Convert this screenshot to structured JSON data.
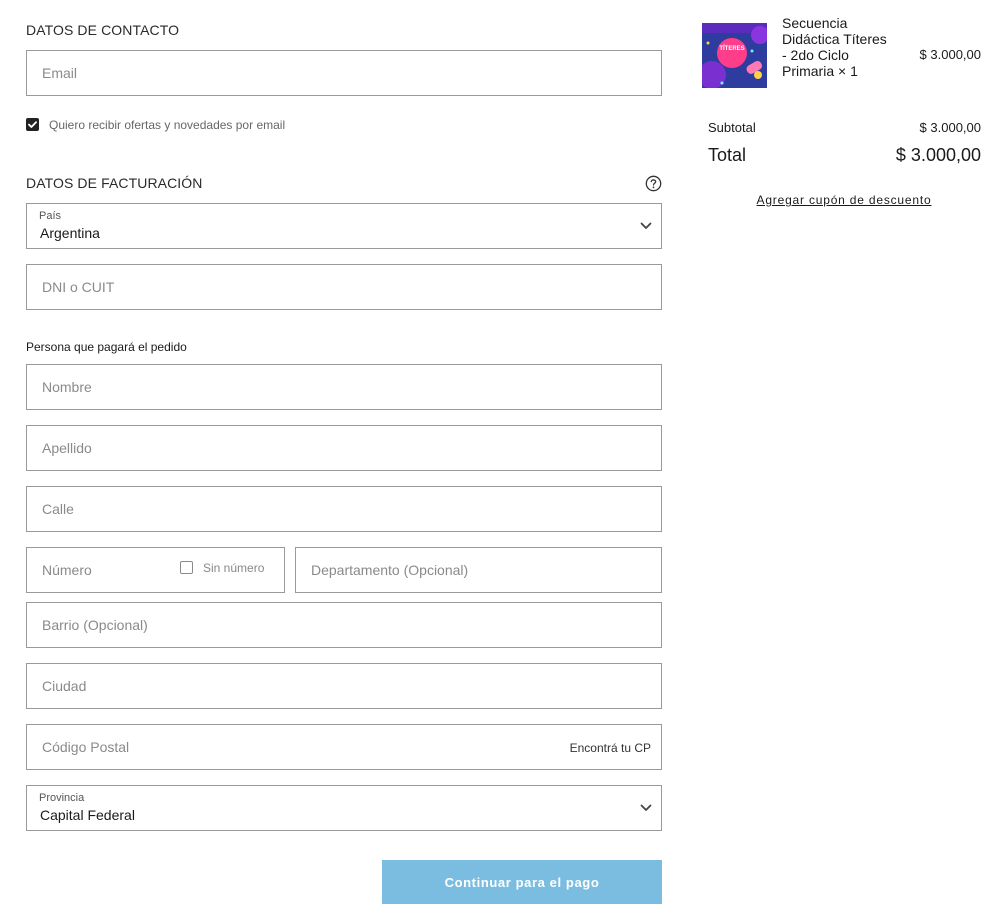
{
  "contact": {
    "title": "DATOS DE CONTACTO",
    "email_placeholder": "Email",
    "offers_label": "Quiero recibir ofertas y novedades por email"
  },
  "billing": {
    "title": "DATOS DE FACTURACIÓN",
    "help_icon": "question-circle-icon",
    "country_label": "País",
    "country_value": "Argentina",
    "dni_placeholder": "DNI o CUIT",
    "payer_title": "Persona que pagará el pedido",
    "name_placeholder": "Nombre",
    "lastname_placeholder": "Apellido",
    "street_placeholder": "Calle",
    "number_placeholder": "Número",
    "no_number_label": "Sin número",
    "apartment_placeholder": "Departamento (Opcional)",
    "neighborhood_placeholder": "Barrio (Opcional)",
    "city_placeholder": "Ciudad",
    "postal_placeholder": "Código Postal",
    "find_postal_link": "Encontrá tu CP",
    "province_label": "Provincia",
    "province_value": "Capital Federal"
  },
  "continue_button": "Continuar para el pago",
  "cart": {
    "item": {
      "name": "Secuencia Didáctica Títeres - 2do Ciclo Primaria × 1",
      "price": "$ 3.000,00",
      "thumb_title": "TÍTERES"
    },
    "subtotal_label": "Subtotal",
    "subtotal_value": "$ 3.000,00",
    "total_label": "Total",
    "total_value": "$ 3.000,00",
    "coupon_link": "Agregar cupón de descuento"
  },
  "colors": {
    "button": "#7bbde1",
    "border": "#9a9a9a",
    "thumb_bg": "#2a3a9a",
    "thumb_accent": "#ff3d8a"
  }
}
